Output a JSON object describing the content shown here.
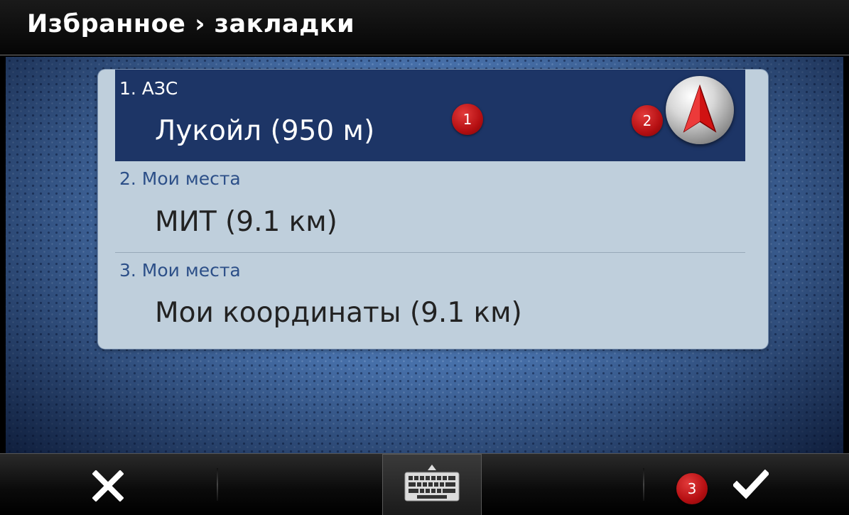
{
  "header": {
    "title": "Избранное › закладки"
  },
  "list": {
    "items": [
      {
        "category": "1. АЗС",
        "name": "Лукойл (950 м)",
        "selected": true
      },
      {
        "category": "2. Мои места",
        "name": "МИТ (9.1 км)",
        "selected": false
      },
      {
        "category": "3. Мои места",
        "name": "Мои координаты (9.1 км)",
        "selected": false
      }
    ],
    "navigate_icon": "navigation-arrow-icon"
  },
  "callouts": [
    "1",
    "2",
    "3"
  ],
  "toolbar": {
    "cancel_icon": "close-icon",
    "keyboard_icon": "keyboard-icon",
    "confirm_icon": "checkmark-icon"
  },
  "colors": {
    "selected_row": "#1d3566",
    "list_background": "#bfcfdc",
    "category_text": "#2c4f88",
    "callout_badge": "#c4161c",
    "screen_background": "#4a74ae"
  }
}
